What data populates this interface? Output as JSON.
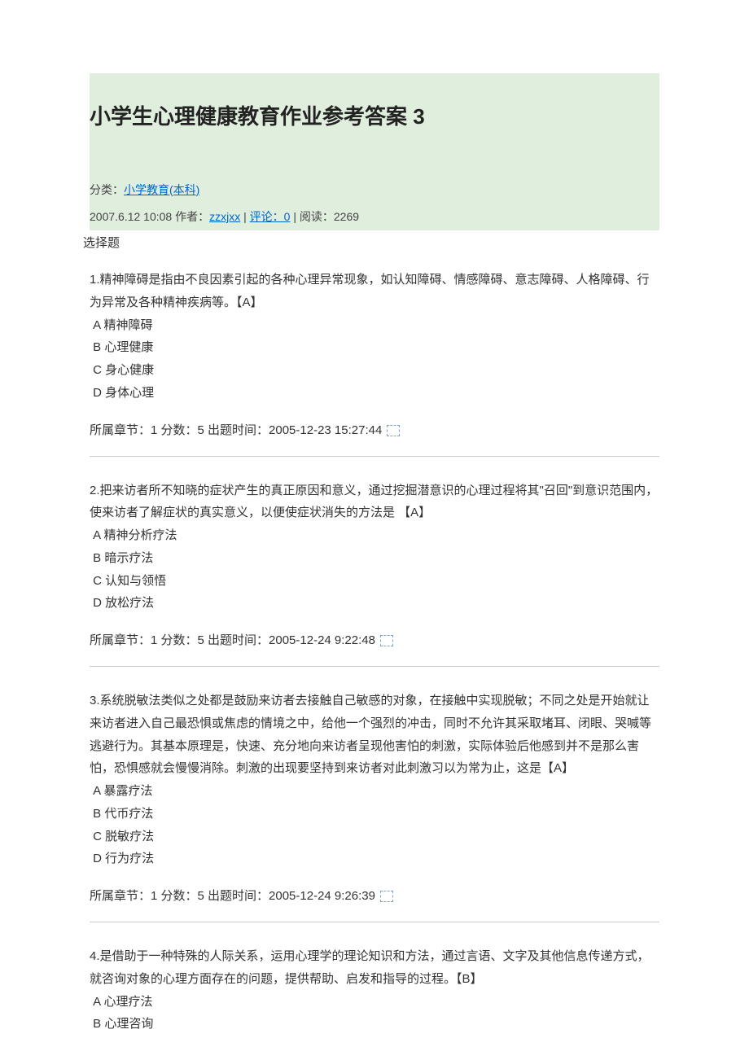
{
  "header": {
    "title": "小学生心理健康教育作业参考答案 3",
    "category_label": "分类：",
    "category_link": "小学教育(本科)",
    "date": "2007.6.12 10:08",
    "author_label": "作者：",
    "author": "zzxjxx",
    "comments_label": "评论：0",
    "reads_label": "阅读：2269"
  },
  "section_label": "选择题",
  "questions": [
    {
      "text": "1.精神障碍是指由不良因素引起的各种心理异常现象，如认知障碍、情感障碍、意志障碍、人格障碍、行为异常及各种精神疾病等。【A】",
      "options": [
        "A 精神障碍",
        "B 心理健康",
        "C 身心健康",
        "D 身体心理"
      ],
      "meta": "所属章节：1  分数：5  出题时间：2005-12-23 15:27:44"
    },
    {
      "text": "2.把来访者所不知晓的症状产生的真正原因和意义，通过挖掘潜意识的心理过程将其\"召回\"到意识范围内，使来访者了解症状的真实意义，以便使症状消失的方法是 【A】",
      "options": [
        "A 精神分析疗法",
        "B 暗示疗法",
        "C 认知与领悟",
        "D 放松疗法"
      ],
      "meta": "所属章节：1  分数：5  出题时间：2005-12-24 9:22:48"
    },
    {
      "text": "3.系统脱敏法类似之处都是鼓励来访者去接触自己敏感的对象，在接触中实现脱敏；不同之处是开始就让来访者进入自己最恐惧或焦虑的情境之中，给他一个强烈的冲击，同时不允许其采取堵耳、闭眼、哭喊等逃避行为。其基本原理是，快速、充分地向来访者呈现他害怕的刺激，实际体验后他感到并不是那么害怕，恐惧感就会慢慢消除。刺激的出现要坚持到来访者对此刺激习以为常为止，这是【A】",
      "options": [
        "A 暴露疗法",
        "B 代币疗法",
        "C 脱敏疗法",
        "D 行为疗法"
      ],
      "meta": "所属章节：1  分数：5  出题时间：2005-12-24 9:26:39"
    },
    {
      "text": "4.是借助于一种特殊的人际关系，运用心理学的理论知识和方法，通过言语、文字及其他信息传递方式，就咨询对象的心理方面存在的问题，提供帮助、启发和指导的过程。【B】",
      "options": [
        "A 心理疗法",
        "B 心理咨询"
      ],
      "meta": ""
    }
  ]
}
